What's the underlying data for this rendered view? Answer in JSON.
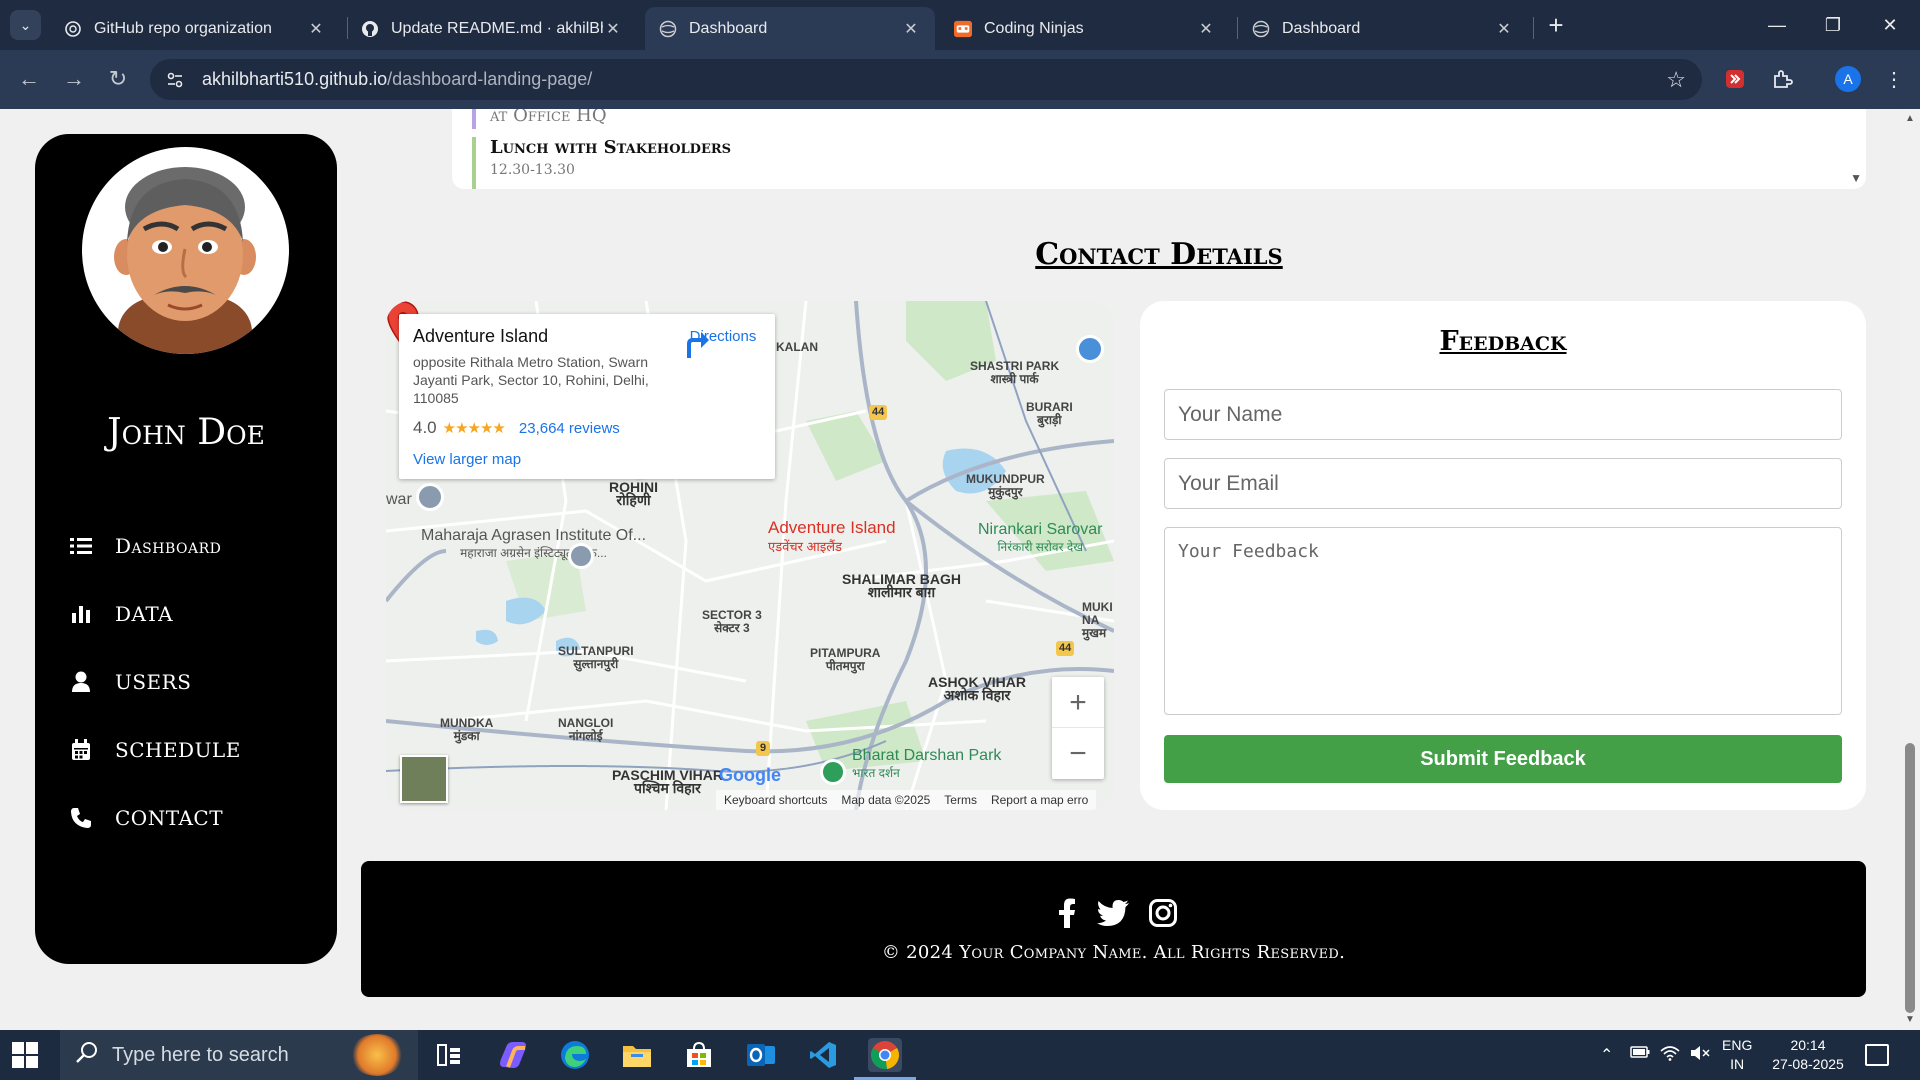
{
  "browser": {
    "tabs": [
      {
        "title": "GitHub repo organization",
        "favicon": "chatgpt-icon"
      },
      {
        "title": "Update README.md · akhilBhar",
        "favicon": "github-icon"
      },
      {
        "title": "Dashboard",
        "favicon": "globe-icon",
        "active": true
      },
      {
        "title": "Coding Ninjas",
        "favicon": "coding-ninjas-icon"
      },
      {
        "title": "Dashboard",
        "favicon": "globe-icon"
      }
    ],
    "url_host": "akhilbharti510.github.io",
    "url_path": "/dashboard-landing-page/",
    "profile_initial": "A"
  },
  "sidebar": {
    "user_name": "John Doe",
    "items": [
      {
        "label": "Dashboard",
        "icon": "list-icon"
      },
      {
        "label": "DATA",
        "icon": "bar-chart-icon"
      },
      {
        "label": "USERS",
        "icon": "user-icon"
      },
      {
        "label": "SCHEDULE",
        "icon": "calendar-icon"
      },
      {
        "label": "CONTACT",
        "icon": "phone-icon"
      }
    ]
  },
  "schedule": {
    "prev_sub": "at Office HQ",
    "item_title": "Lunch with Stakeholders",
    "item_time": "12.30-13.30"
  },
  "contact": {
    "heading": "Contact Details"
  },
  "map": {
    "place_name": "Adventure Island",
    "address": "opposite Rithala Metro Station, Swarn Jayanti Park, Sector 10, Rohini, Delhi, 110085",
    "rating": "4.0",
    "stars": "★★★★★",
    "reviews": "23,664 reviews",
    "directions": "Directions",
    "view_larger": "View larger map",
    "pin_label": "Adventure Island",
    "pin_label_hindi": "एडवेंचर आइलैंड",
    "labels": {
      "kalan": "KALAN",
      "shastri_park": "SHASTRI PARK",
      "shastri_park_hi": "शास्त्री पार्क",
      "burari": "BURARI",
      "burari_hi": "बुराड़ी",
      "rohini": "ROHINI",
      "rohini_hi": "रोहिणी",
      "mukundpur": "MUKUNDPUR",
      "mukundpur_hi": "मुकुंदपुर",
      "nirankari": "Nirankari Sarovar",
      "nirankari_hi": "निरंकारी सरोवर देख",
      "maharaja": "Maharaja Agrasen Institute Of...",
      "maharaja_hi": "महाराजा अग्रसेन इंस्टिट्यूट ऑफ़...",
      "war": "war",
      "shalimar": "SHALIMAR BAGH",
      "shalimar_hi": "शालीमार बाग़",
      "sector3": "SECTOR 3",
      "sector3_hi": "सेक्टर 3",
      "sultanpuri": "SULTANPURI",
      "sultanpuri_hi": "सुल्तानपुरी",
      "pitampura": "PITAMPURA",
      "pitampura_hi": "पीतमपुरा",
      "ashok_vihar": "ASHOK VIHAR",
      "ashok_vihar_hi": "अशोक विहार",
      "muki": "MUKI",
      "na": "NA",
      "mukh": "मुखम",
      "mundka": "MUNDKA",
      "mundka_hi": "मुंडका",
      "nangloi": "NANGLOI",
      "nangloi_hi": "नांगलोई",
      "paschim": "PASCHIM VIHAR",
      "paschim_hi": "पश्चिम विहार",
      "bharat": "Bharat Darshan Park",
      "bharat_hi": "भारत दर्शन",
      "nh44": "44",
      "nh9": "9"
    },
    "google": "Google",
    "footer": [
      "Keyboard shortcuts",
      "Map data ©2025",
      "Terms",
      "Report a map erro"
    ]
  },
  "feedback": {
    "heading": "Feedback",
    "name_placeholder": "Your Name",
    "email_placeholder": "Your Email",
    "feedback_placeholder": "Your Feedback",
    "submit_label": "Submit Feedback"
  },
  "footer": {
    "copyright": "© 2024 Your Company Name. All Rights Reserved.",
    "social": [
      "facebook-icon",
      "twitter-icon",
      "instagram-icon"
    ]
  },
  "taskbar": {
    "search_placeholder": "Type here to search",
    "lang_top": "ENG",
    "lang_bottom": "IN",
    "time": "20:14",
    "date": "27-08-2025"
  }
}
